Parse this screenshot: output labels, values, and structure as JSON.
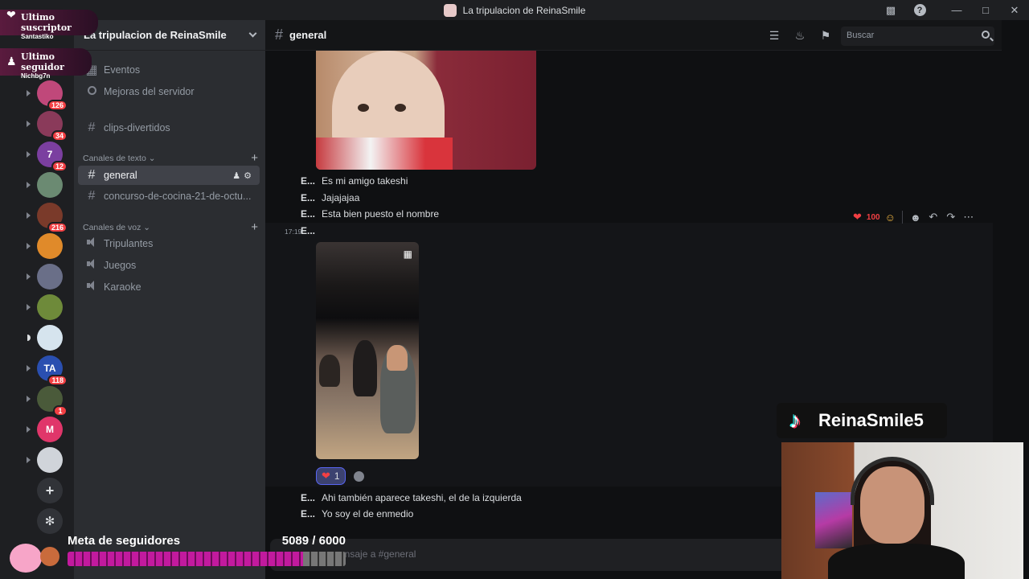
{
  "window": {
    "title": "La tripulacion de ReinaSmile"
  },
  "rail": {
    "servers": [
      {
        "initial": "",
        "color": "#c0487a",
        "badge": "126"
      },
      {
        "initial": "",
        "color": "#8a3a5a",
        "badge": "34"
      },
      {
        "initial": "7",
        "color": "#7b3fa0",
        "badge": "12"
      },
      {
        "initial": "",
        "color": "#6b8a72",
        "badge": ""
      },
      {
        "initial": "",
        "color": "#7a3a2a",
        "badge": "216"
      },
      {
        "initial": "",
        "color": "#e08a2a",
        "badge": ""
      },
      {
        "initial": "",
        "color": "#6a6f88",
        "badge": ""
      },
      {
        "initial": "",
        "color": "#6e8a3a",
        "badge": ""
      },
      {
        "initial": "",
        "color": "#d6e4ee",
        "badge": ""
      },
      {
        "initial": "TA",
        "color": "#2a4fb0",
        "badge": "118"
      },
      {
        "initial": "",
        "color": "#4a5a3a",
        "badge": "1"
      },
      {
        "initial": "M",
        "color": "#e0366a",
        "badge": ""
      },
      {
        "initial": "",
        "color": "#d0d4da",
        "badge": ""
      }
    ]
  },
  "sidebar": {
    "guild_name": "La tripulacion de ReinaSmile",
    "events": "Eventos",
    "boosts": "Mejoras del servidor",
    "clips": "clips-divertidos",
    "text_category": "Canales de texto",
    "text_channels": [
      "general",
      "concurso-de-cocina-21-de-octu..."
    ],
    "voice_category": "Canales de voz",
    "voice_channels": [
      "Tripulantes",
      "Juegos",
      "Karaoke"
    ]
  },
  "header": {
    "channel": "general",
    "search_placeholder": "Buscar"
  },
  "messages": {
    "author_short": "E...",
    "group1": [
      "Es mi amigo takeshi",
      "Jajajajaa",
      "Esta bien puesto el nombre"
    ],
    "timestamp": "17:19",
    "reaction_count": "1",
    "group2": [
      "Ahi también aparece takeshi, el de la izquierda",
      "Yo soy el de enmedio"
    ]
  },
  "composer": {
    "placeholder": "ensaje a #general"
  },
  "overlay": {
    "sub_title": "Ultimo suscriptor",
    "sub_name": "Santastiko",
    "fol_title": "Ultimo seguidor",
    "fol_name": "Nichbg7n",
    "goal_label": "Meta de seguidores",
    "goal_count": "5089 / 6000",
    "goal_current": 5089,
    "goal_target": 6000,
    "tiktok_handle": "ReinaSmile5"
  },
  "colors": {
    "accent": "#5865f2",
    "danger": "#f23f43",
    "goal_fill": "#c21a9e"
  }
}
